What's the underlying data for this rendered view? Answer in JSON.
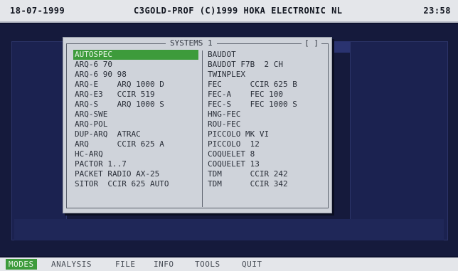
{
  "statusbar": {
    "date": "18-07-1999",
    "title": "C3GOLD-PROF (C)1999 HOKA ELECTRONIC NL",
    "time": "23:58"
  },
  "dialog": {
    "title": "SYSTEMS 1",
    "close_label": "[ ]",
    "left_items": [
      "AUTOSPEC",
      "ARQ-6 70",
      "ARQ-6 90 98",
      "ARQ-E    ARQ 1000 D",
      "ARQ-E3   CCIR 519",
      "ARQ-S    ARQ 1000 S",
      "ARQ-SWE",
      "ARQ-POL",
      "DUP-ARQ  ATRAC",
      "ARQ      CCIR 625 A",
      "HC-ARQ",
      "PACTOR 1..7",
      "PACKET RADIO AX-25",
      "SITOR  CCIR 625 AUTO"
    ],
    "right_items": [
      "BAUDOT",
      "BAUDOT F7B  2 CH",
      "TWINPLEX",
      "FEC      CCIR 625 B",
      "FEC-A    FEC 100",
      "FEC-S    FEC 1000 S",
      "HNG-FEC",
      "ROU-FEC",
      "PICCOLO MK VI",
      "PICCOLO  12",
      "COQUELET 8",
      "COQUELET 13",
      "TDM      CCIR 242",
      "TDM      CCIR 342"
    ]
  },
  "menubar": {
    "items": [
      "MODES",
      "ANALYSIS",
      "FILE",
      "INFO",
      "TOOLS",
      "QUIT"
    ]
  },
  "colors": {
    "highlight": "#3d9b3b",
    "background": "#151a3c",
    "panel": "#cfd3da"
  }
}
